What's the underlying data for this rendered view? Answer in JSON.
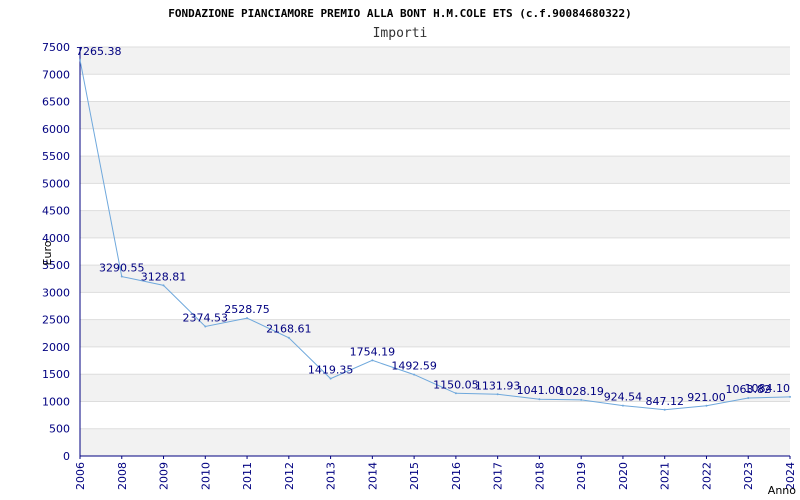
{
  "chart_data": {
    "type": "line",
    "title": "FONDAZIONE PIANCIAMORE PREMIO ALLA BONT H.M.COLE ETS (c.f.90084680322)",
    "subtitle": "Importi",
    "xlabel": "Anno",
    "ylabel": "Euro",
    "categories": [
      "2006",
      "2008",
      "2009",
      "2010",
      "2011",
      "2012",
      "2013",
      "2014",
      "2015",
      "2016",
      "2017",
      "2018",
      "2019",
      "2020",
      "2021",
      "2022",
      "2023",
      "2024"
    ],
    "series": [
      {
        "values": [
          7265.38,
          3290.55,
          3128.81,
          2374.53,
          2528.75,
          2168.61,
          1419.35,
          1754.19,
          1492.59,
          1150.05,
          1131.93,
          1041.0,
          1028.19,
          924.54,
          847.12,
          921.0,
          1063.82,
          1084.1
        ],
        "labels": [
          "7265.38",
          "3290.55",
          "3128.81",
          "2374.53",
          "2528.75",
          "2168.61",
          "1419.35",
          "1754.19",
          "1492.59",
          "1150.05",
          "1131.93",
          "1041.00",
          "1028.19",
          "924.54",
          "847.12",
          "921.00",
          "1063.82",
          "1084.10"
        ],
        "color": "#6fa8dc"
      }
    ],
    "ylim": [
      0,
      7500
    ],
    "yticks": [
      0,
      500,
      1000,
      1500,
      2000,
      2500,
      3000,
      3500,
      4000,
      4500,
      5000,
      5500,
      6000,
      6500,
      7000,
      7500
    ],
    "grid": true,
    "band_colors": [
      "#f2f2f2",
      "#ffffff"
    ],
    "axis_color": "#000080"
  }
}
